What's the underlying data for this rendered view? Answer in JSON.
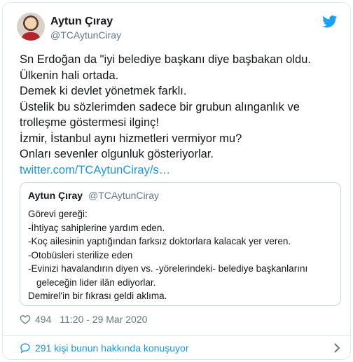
{
  "user": {
    "name": "Aytun Çıray",
    "handle": "@TCAytunCiray"
  },
  "tweet": {
    "lines": [
      "Sn Erdoğan da \"iyi belediye başkanı diye başbakan oldu.",
      "Ülkenin hali ortada.",
      "Demek ki devlet yönetmek farklı.",
      "Üstelik bu sözlerimden sadece bir grubun alınganlık ve trolleşme göstermesi ilginç!",
      "İzmir, İstanbul aynı hizmetleri vermiyor mu?",
      "Onları sevenler olgunluk gösteriyorlar."
    ],
    "link": "twitter.com/TCAytunCiray/s…"
  },
  "quote": {
    "name": "Aytun Çıray",
    "handle": "@TCAytunCiray",
    "lines": [
      "Görevi gereği:",
      "-İhtiyaç sahiplerine yardım eden.",
      "-Koç ailesinin yaptığından farksız doktorlara kalacak yer veren.",
      "-Otobüsleri sterilize eden",
      "-Evinizi havalandırın diyen vs. -yörelerindeki- belediye başkanlarını",
      "geleceğin lider ilân ediyorlar.",
      "Demirel'in bir fıkrası geldi aklıma."
    ]
  },
  "meta": {
    "likes": "494",
    "timestamp": "11:20 - 29 Mar 2020"
  },
  "footer": {
    "conversation": "291 kişi bunun hakkında konuşuyor"
  },
  "icons": {
    "bird": "twitter-bird-icon",
    "heart": "heart-icon",
    "bubble": "speech-bubble-icon",
    "chevron": "chevron-right-icon"
  },
  "colors": {
    "brand": "#1da1f2",
    "link": "#1b95e0",
    "muted": "#657786",
    "border": "#e1e8ed"
  }
}
